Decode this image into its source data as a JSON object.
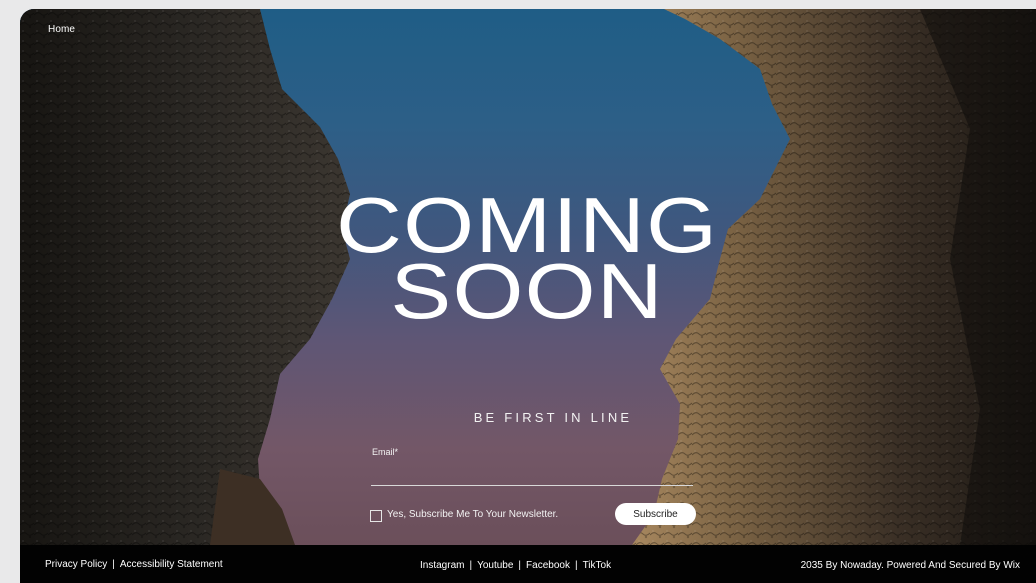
{
  "nav": {
    "home_label": "Home"
  },
  "hero": {
    "headline_line1": "COMING",
    "headline_line2": "SOON",
    "tagline": "BE FIRST IN LINE"
  },
  "form": {
    "email_label": "Email*",
    "email_value": "",
    "newsletter_label": "Yes, Subscribe Me To Your Newsletter.",
    "newsletter_checked": false,
    "subscribe_label": "Subscribe"
  },
  "footer": {
    "left_links": [
      "Privacy Policy",
      "Accessibility Statement"
    ],
    "center_links": [
      "Instagram",
      "Youtube",
      "Facebook",
      "TikTok"
    ],
    "separator": "|",
    "copyright": "2035 By Nowaday. Powered And Secured By Wix"
  },
  "colors": {
    "sky_top": "#1f5d86",
    "sky_bottom": "#6b4f5a",
    "footer_bg": "#020202",
    "text": "#ffffff"
  }
}
